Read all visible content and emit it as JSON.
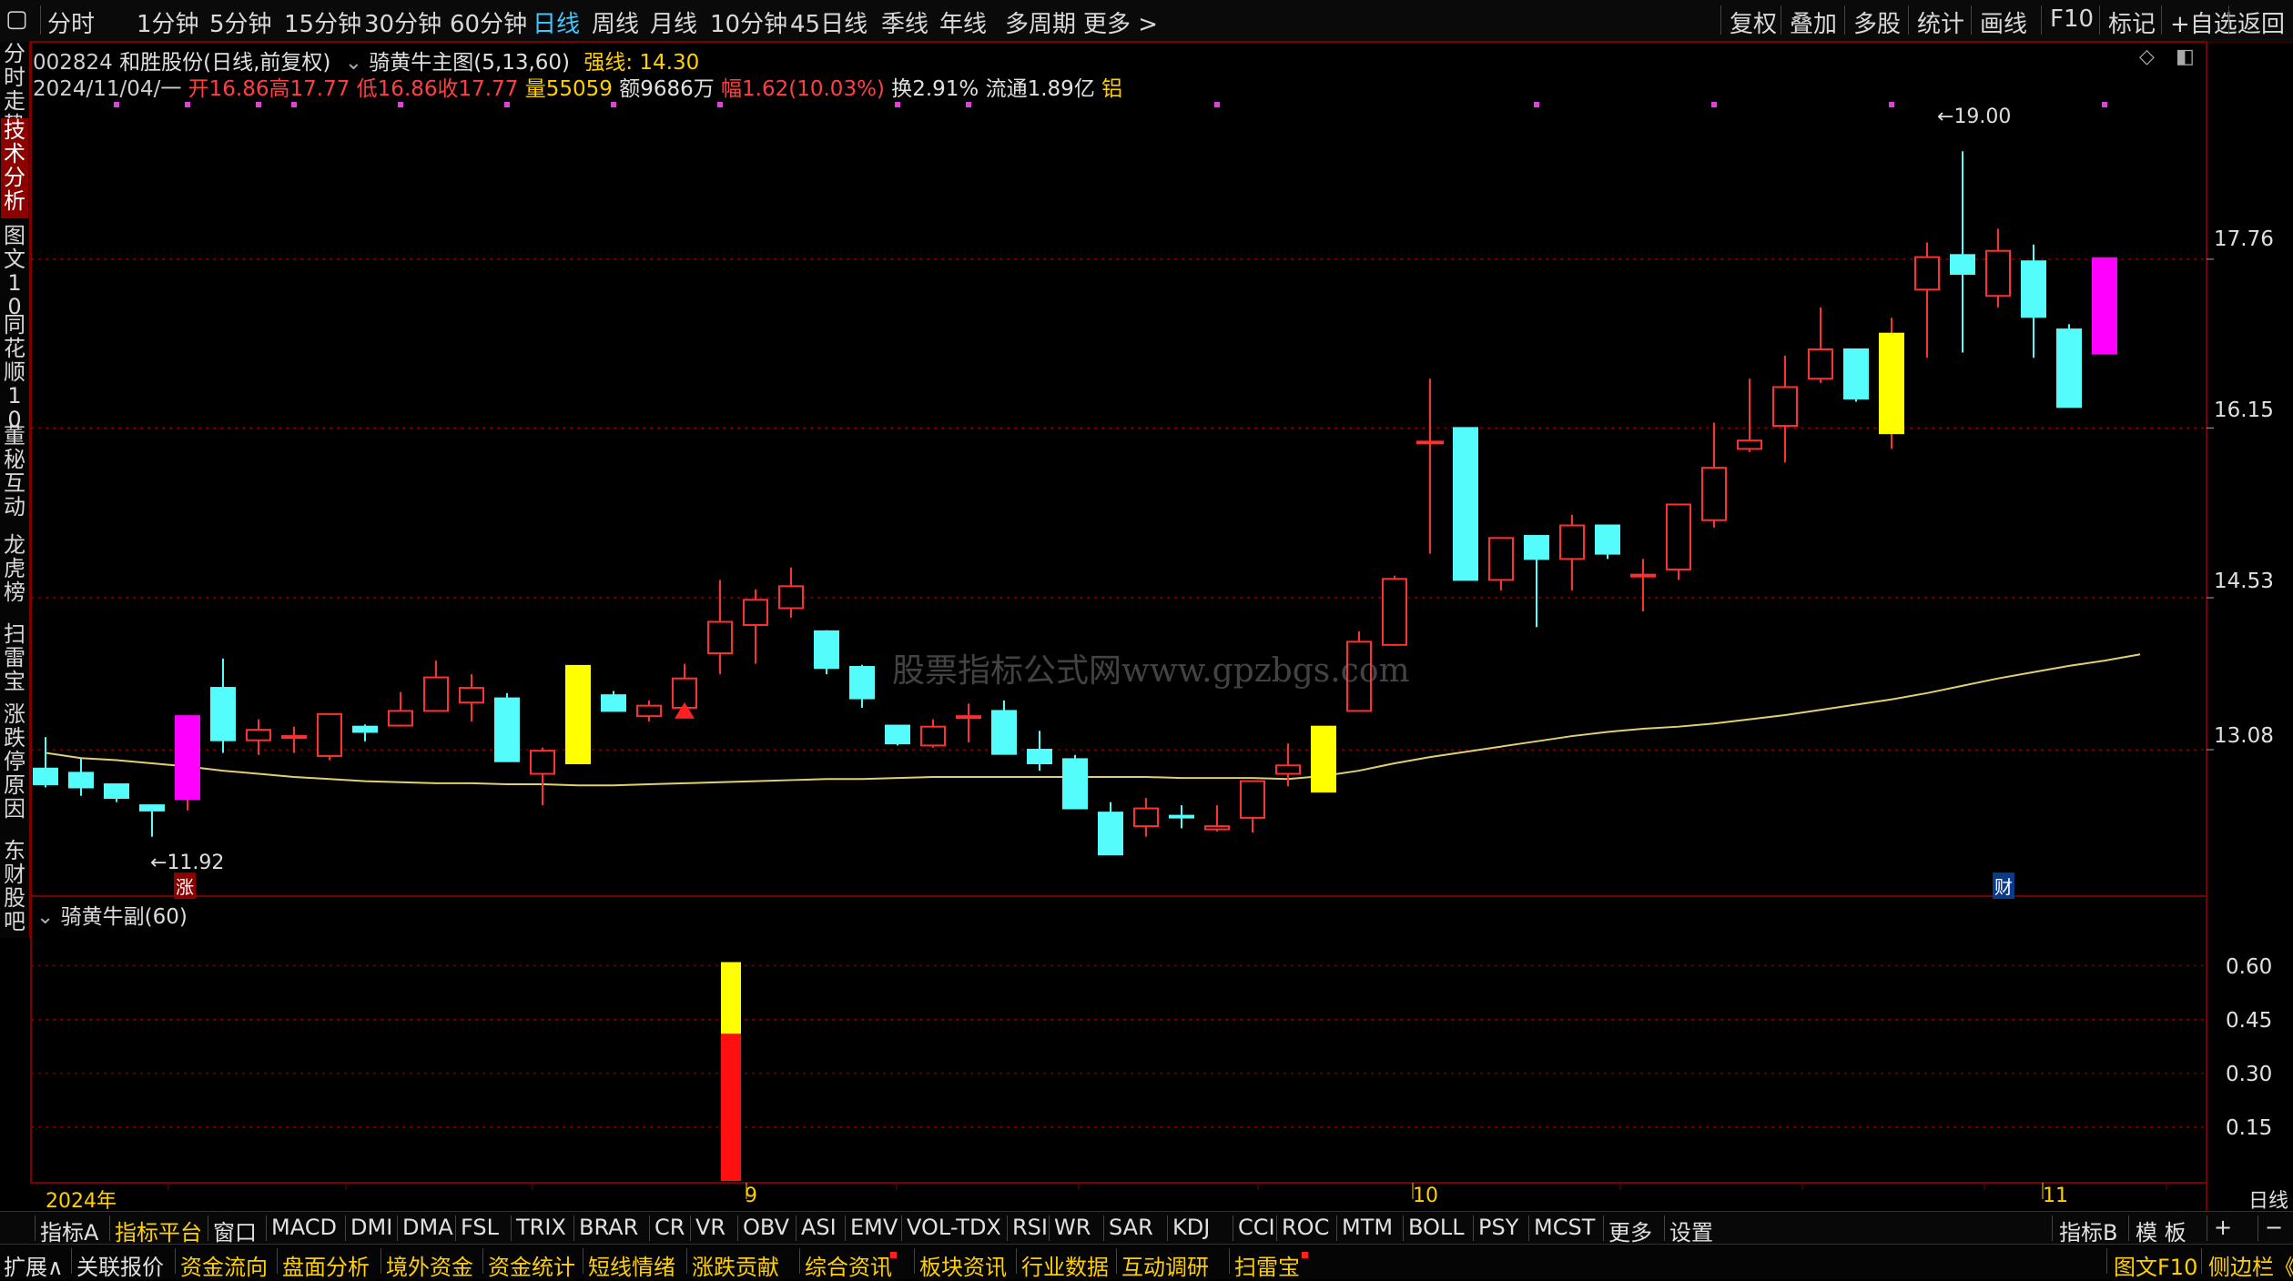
{
  "colors": {
    "up": "#ff3030",
    "down": "#54fcfc",
    "ma": "#e0d070",
    "special_up": "#ff00ff",
    "special_yellow": "#ffff00",
    "grid": "#7a0000"
  },
  "top_tabs": [
    "分时",
    "1分钟",
    "5分钟",
    "15分钟",
    "30分钟",
    "60分钟",
    "日线",
    "周线",
    "月线",
    "10分钟",
    "45日线",
    "季线",
    "年线",
    "多周期",
    "更多 >"
  ],
  "top_right": [
    "复权",
    "叠加",
    "多股",
    "统计",
    "画线",
    "F10",
    "标记",
    "+自选",
    "返回"
  ],
  "left_tabs": [
    "分时走势",
    "技术分析",
    "图文10",
    "同花顺10",
    "董秘互动",
    "龙虎榜",
    "扫雷宝",
    "涨跌停原因",
    "东财股吧"
  ],
  "stock_line": {
    "code": "002824",
    "name": "和胜股份",
    "mode": "(日线,前复权)",
    "indicator": "骑黄牛主图(5,13,60)",
    "strong_label": "强线:",
    "strong_value": "14.30"
  },
  "quote_line": {
    "date": "2024/11/04/一",
    "open": "开16.86",
    "high": "高17.77",
    "low": "低16.86",
    "close": "收17.77",
    "vol": "量55059",
    "amount": "额9686万",
    "range": "幅1.62(10.03%)",
    "turnover": "换2.91%",
    "float": "流通1.89亿",
    "tag": "铝"
  },
  "price_axis": [
    "17.76",
    "16.15",
    "14.53",
    "13.08"
  ],
  "sub_axis": [
    "0.60",
    "0.45",
    "0.30",
    "0.15"
  ],
  "annotations": {
    "high": "19.00",
    "low": "11.92",
    "zhang": "涨",
    "cai": "财"
  },
  "sub_title": "骑黄牛副(60)",
  "x_labels": [
    "2024年",
    "9",
    "10",
    "11"
  ],
  "right_bottom_label": "日线",
  "watermark": "股票指标公式网www.gpzbgs.com",
  "indicator_tabs": [
    "指标A",
    "指标平台",
    "窗口",
    "MACD",
    "DMI",
    "DMA",
    "FSL",
    "TRIX",
    "BRAR",
    "CR",
    "VR",
    "OBV",
    "ASI",
    "EMV",
    "VOL-TDX",
    "RSI",
    "WR",
    "SAR",
    "KDJ",
    "CCI",
    "ROC",
    "MTM",
    "BOLL",
    "PSY",
    "MCST",
    "更多",
    "设置"
  ],
  "indicator_right": [
    "指标B",
    "模 板",
    "+",
    "−"
  ],
  "bottom_tabs": [
    "扩展∧",
    "关联报价",
    "资金流向",
    "盘面分析",
    "境外资金",
    "资金统计",
    "短线情绪",
    "涨跌贡献",
    "综合资讯",
    "板块资讯",
    "行业数据",
    "互动调研",
    "扫雷宝"
  ],
  "bottom_right": [
    "图文F10",
    "侧边栏《"
  ],
  "chart_data": {
    "type": "candlestick",
    "ylim": [
      11.7,
      19.4
    ],
    "candles": [
      {
        "o": 12.9,
        "h": 13.2,
        "l": 12.72,
        "c": 12.75
      },
      {
        "o": 12.86,
        "h": 13.0,
        "l": 12.64,
        "c": 12.72
      },
      {
        "o": 12.75,
        "h": 12.75,
        "l": 12.58,
        "c": 12.62
      },
      {
        "o": 12.55,
        "h": 12.55,
        "l": 12.25,
        "c": 12.5
      },
      {
        "o": 12.61,
        "h": 13.4,
        "l": 12.5,
        "c": 13.4,
        "color": "magenta"
      },
      {
        "o": 13.67,
        "h": 13.95,
        "l": 13.05,
        "c": 13.17
      },
      {
        "o": 13.17,
        "h": 13.37,
        "l": 13.03,
        "c": 13.27
      },
      {
        "o": 13.2,
        "h": 13.3,
        "l": 13.05,
        "c": 13.21
      },
      {
        "o": 13.02,
        "h": 13.42,
        "l": 12.98,
        "c": 13.42
      },
      {
        "o": 13.3,
        "h": 13.32,
        "l": 13.16,
        "c": 13.25
      },
      {
        "o": 13.31,
        "h": 13.63,
        "l": 13.3,
        "c": 13.45
      },
      {
        "o": 13.45,
        "h": 13.93,
        "l": 13.45,
        "c": 13.77
      },
      {
        "o": 13.53,
        "h": 13.8,
        "l": 13.35,
        "c": 13.67
      },
      {
        "o": 13.57,
        "h": 13.62,
        "l": 12.97,
        "c": 12.97
      },
      {
        "o": 12.85,
        "h": 13.1,
        "l": 12.55,
        "c": 13.07
      },
      {
        "o": 12.95,
        "h": 13.88,
        "l": 12.95,
        "c": 13.88,
        "color": "yellow"
      },
      {
        "o": 13.6,
        "h": 13.64,
        "l": 13.45,
        "c": 13.45
      },
      {
        "o": 13.4,
        "h": 13.55,
        "l": 13.35,
        "c": 13.5
      },
      {
        "o": 13.48,
        "h": 13.9,
        "l": 13.4,
        "c": 13.76
      },
      {
        "o": 14.0,
        "h": 14.7,
        "l": 13.8,
        "c": 14.3
      },
      {
        "o": 14.27,
        "h": 14.61,
        "l": 13.9,
        "c": 14.51
      },
      {
        "o": 14.43,
        "h": 14.82,
        "l": 14.34,
        "c": 14.64
      },
      {
        "o": 14.21,
        "h": 14.22,
        "l": 13.8,
        "c": 13.86
      },
      {
        "o": 13.87,
        "h": 13.89,
        "l": 13.48,
        "c": 13.57
      },
      {
        "o": 13.31,
        "h": 13.31,
        "l": 13.12,
        "c": 13.14
      },
      {
        "o": 13.12,
        "h": 13.37,
        "l": 13.1,
        "c": 13.3
      },
      {
        "o": 13.4,
        "h": 13.52,
        "l": 13.15,
        "c": 13.4
      },
      {
        "o": 13.45,
        "h": 13.55,
        "l": 13.04,
        "c": 13.04
      },
      {
        "o": 13.08,
        "h": 13.26,
        "l": 12.88,
        "c": 12.95
      },
      {
        "o": 12.99,
        "h": 13.03,
        "l": 12.52,
        "c": 12.52
      },
      {
        "o": 12.48,
        "h": 12.58,
        "l": 12.08,
        "c": 12.08
      },
      {
        "o": 12.35,
        "h": 12.62,
        "l": 12.25,
        "c": 12.52
      },
      {
        "o": 12.45,
        "h": 12.55,
        "l": 12.33,
        "c": 12.44
      },
      {
        "o": 12.32,
        "h": 12.55,
        "l": 12.3,
        "c": 12.35
      },
      {
        "o": 12.43,
        "h": 12.78,
        "l": 12.29,
        "c": 12.78
      },
      {
        "o": 12.85,
        "h": 13.14,
        "l": 12.73,
        "c": 12.93
      },
      {
        "o": 12.68,
        "h": 13.3,
        "l": 12.68,
        "c": 13.3,
        "color": "yellow"
      },
      {
        "o": 13.45,
        "h": 14.21,
        "l": 13.45,
        "c": 14.11
      },
      {
        "o": 14.08,
        "h": 14.74,
        "l": 14.07,
        "c": 14.71
      },
      {
        "o": 16.02,
        "h": 16.62,
        "l": 14.95,
        "c": 16.02,
        "color": "split"
      },
      {
        "o": 16.15,
        "h": 16.15,
        "l": 14.7,
        "c": 14.7
      },
      {
        "o": 14.7,
        "h": 15.1,
        "l": 14.6,
        "c": 15.1
      },
      {
        "o": 15.12,
        "h": 15.12,
        "l": 14.25,
        "c": 14.9
      },
      {
        "o": 14.9,
        "h": 15.32,
        "l": 14.6,
        "c": 15.22
      },
      {
        "o": 15.22,
        "h": 15.22,
        "l": 14.9,
        "c": 14.95
      },
      {
        "o": 14.75,
        "h": 14.9,
        "l": 14.4,
        "c": 14.75
      },
      {
        "o": 14.8,
        "h": 15.2,
        "l": 14.7,
        "c": 15.42
      },
      {
        "o": 15.27,
        "h": 16.2,
        "l": 15.2,
        "c": 15.77
      },
      {
        "o": 15.95,
        "h": 16.62,
        "l": 15.92,
        "c": 16.03
      },
      {
        "o": 16.17,
        "h": 16.84,
        "l": 15.82,
        "c": 16.54
      },
      {
        "o": 16.62,
        "h": 17.3,
        "l": 16.58,
        "c": 16.9
      },
      {
        "o": 16.9,
        "h": 16.9,
        "l": 16.4,
        "c": 16.43
      },
      {
        "o": 16.1,
        "h": 17.2,
        "l": 15.95,
        "c": 17.05,
        "color": "yellow"
      },
      {
        "o": 17.47,
        "h": 17.92,
        "l": 16.82,
        "c": 17.78
      },
      {
        "o": 17.8,
        "h": 18.79,
        "l": 16.87,
        "c": 17.62
      },
      {
        "o": 17.41,
        "h": 18.05,
        "l": 17.3,
        "c": 17.84
      },
      {
        "o": 17.74,
        "h": 17.9,
        "l": 16.82,
        "c": 17.21
      },
      {
        "o": 17.09,
        "h": 17.14,
        "l": 16.35,
        "c": 16.35
      },
      {
        "o": 16.86,
        "h": 17.77,
        "l": 16.86,
        "c": 17.77,
        "color": "magenta"
      }
    ],
    "ma60": [
      13.05,
      13.0,
      12.98,
      12.95,
      12.92,
      12.88,
      12.85,
      12.82,
      12.8,
      12.78,
      12.77,
      12.76,
      12.76,
      12.75,
      12.75,
      12.74,
      12.74,
      12.75,
      12.76,
      12.77,
      12.78,
      12.79,
      12.8,
      12.8,
      12.81,
      12.82,
      12.82,
      12.82,
      12.82,
      12.82,
      12.82,
      12.82,
      12.81,
      12.81,
      12.81,
      12.8,
      12.83,
      12.88,
      12.95,
      13.01,
      13.06,
      13.11,
      13.16,
      13.21,
      13.25,
      13.28,
      13.3,
      13.33,
      13.37,
      13.41,
      13.46,
      13.51,
      13.56,
      13.62,
      13.69,
      13.76,
      13.82,
      13.88,
      13.93,
      13.99
    ],
    "sub_bar": {
      "index": 19,
      "total": 0.61,
      "red_part": 0.41
    },
    "sub_ylim": [
      0,
      0.7
    ],
    "dot_indices": [
      2,
      4,
      6,
      7,
      10,
      13,
      16,
      19,
      24,
      26,
      33,
      42,
      47,
      52,
      58
    ]
  }
}
